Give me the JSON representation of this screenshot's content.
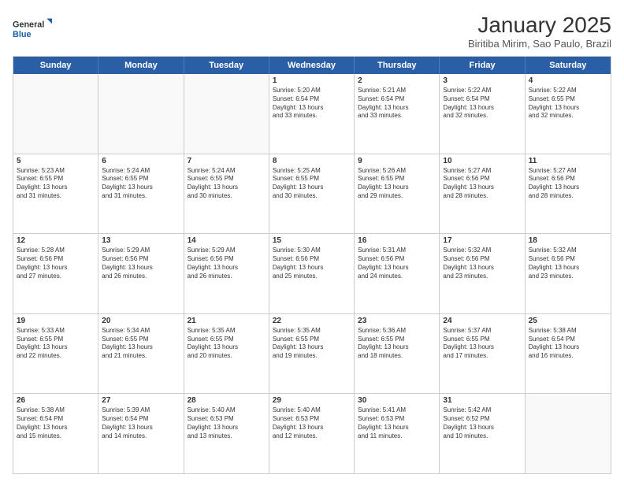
{
  "logo": {
    "line1": "General",
    "line2": "Blue"
  },
  "title": "January 2025",
  "subtitle": "Biritiba Mirim, Sao Paulo, Brazil",
  "headers": [
    "Sunday",
    "Monday",
    "Tuesday",
    "Wednesday",
    "Thursday",
    "Friday",
    "Saturday"
  ],
  "weeks": [
    [
      {
        "day": "",
        "info": ""
      },
      {
        "day": "",
        "info": ""
      },
      {
        "day": "",
        "info": ""
      },
      {
        "day": "1",
        "info": "Sunrise: 5:20 AM\nSunset: 6:54 PM\nDaylight: 13 hours\nand 33 minutes."
      },
      {
        "day": "2",
        "info": "Sunrise: 5:21 AM\nSunset: 6:54 PM\nDaylight: 13 hours\nand 33 minutes."
      },
      {
        "day": "3",
        "info": "Sunrise: 5:22 AM\nSunset: 6:54 PM\nDaylight: 13 hours\nand 32 minutes."
      },
      {
        "day": "4",
        "info": "Sunrise: 5:22 AM\nSunset: 6:55 PM\nDaylight: 13 hours\nand 32 minutes."
      }
    ],
    [
      {
        "day": "5",
        "info": "Sunrise: 5:23 AM\nSunset: 6:55 PM\nDaylight: 13 hours\nand 31 minutes."
      },
      {
        "day": "6",
        "info": "Sunrise: 5:24 AM\nSunset: 6:55 PM\nDaylight: 13 hours\nand 31 minutes."
      },
      {
        "day": "7",
        "info": "Sunrise: 5:24 AM\nSunset: 6:55 PM\nDaylight: 13 hours\nand 30 minutes."
      },
      {
        "day": "8",
        "info": "Sunrise: 5:25 AM\nSunset: 6:55 PM\nDaylight: 13 hours\nand 30 minutes."
      },
      {
        "day": "9",
        "info": "Sunrise: 5:26 AM\nSunset: 6:55 PM\nDaylight: 13 hours\nand 29 minutes."
      },
      {
        "day": "10",
        "info": "Sunrise: 5:27 AM\nSunset: 6:56 PM\nDaylight: 13 hours\nand 28 minutes."
      },
      {
        "day": "11",
        "info": "Sunrise: 5:27 AM\nSunset: 6:56 PM\nDaylight: 13 hours\nand 28 minutes."
      }
    ],
    [
      {
        "day": "12",
        "info": "Sunrise: 5:28 AM\nSunset: 6:56 PM\nDaylight: 13 hours\nand 27 minutes."
      },
      {
        "day": "13",
        "info": "Sunrise: 5:29 AM\nSunset: 6:56 PM\nDaylight: 13 hours\nand 26 minutes."
      },
      {
        "day": "14",
        "info": "Sunrise: 5:29 AM\nSunset: 6:56 PM\nDaylight: 13 hours\nand 26 minutes."
      },
      {
        "day": "15",
        "info": "Sunrise: 5:30 AM\nSunset: 6:56 PM\nDaylight: 13 hours\nand 25 minutes."
      },
      {
        "day": "16",
        "info": "Sunrise: 5:31 AM\nSunset: 6:56 PM\nDaylight: 13 hours\nand 24 minutes."
      },
      {
        "day": "17",
        "info": "Sunrise: 5:32 AM\nSunset: 6:56 PM\nDaylight: 13 hours\nand 23 minutes."
      },
      {
        "day": "18",
        "info": "Sunrise: 5:32 AM\nSunset: 6:56 PM\nDaylight: 13 hours\nand 23 minutes."
      }
    ],
    [
      {
        "day": "19",
        "info": "Sunrise: 5:33 AM\nSunset: 6:55 PM\nDaylight: 13 hours\nand 22 minutes."
      },
      {
        "day": "20",
        "info": "Sunrise: 5:34 AM\nSunset: 6:55 PM\nDaylight: 13 hours\nand 21 minutes."
      },
      {
        "day": "21",
        "info": "Sunrise: 5:35 AM\nSunset: 6:55 PM\nDaylight: 13 hours\nand 20 minutes."
      },
      {
        "day": "22",
        "info": "Sunrise: 5:35 AM\nSunset: 6:55 PM\nDaylight: 13 hours\nand 19 minutes."
      },
      {
        "day": "23",
        "info": "Sunrise: 5:36 AM\nSunset: 6:55 PM\nDaylight: 13 hours\nand 18 minutes."
      },
      {
        "day": "24",
        "info": "Sunrise: 5:37 AM\nSunset: 6:55 PM\nDaylight: 13 hours\nand 17 minutes."
      },
      {
        "day": "25",
        "info": "Sunrise: 5:38 AM\nSunset: 6:54 PM\nDaylight: 13 hours\nand 16 minutes."
      }
    ],
    [
      {
        "day": "26",
        "info": "Sunrise: 5:38 AM\nSunset: 6:54 PM\nDaylight: 13 hours\nand 15 minutes."
      },
      {
        "day": "27",
        "info": "Sunrise: 5:39 AM\nSunset: 6:54 PM\nDaylight: 13 hours\nand 14 minutes."
      },
      {
        "day": "28",
        "info": "Sunrise: 5:40 AM\nSunset: 6:53 PM\nDaylight: 13 hours\nand 13 minutes."
      },
      {
        "day": "29",
        "info": "Sunrise: 5:40 AM\nSunset: 6:53 PM\nDaylight: 13 hours\nand 12 minutes."
      },
      {
        "day": "30",
        "info": "Sunrise: 5:41 AM\nSunset: 6:53 PM\nDaylight: 13 hours\nand 11 minutes."
      },
      {
        "day": "31",
        "info": "Sunrise: 5:42 AM\nSunset: 6:52 PM\nDaylight: 13 hours\nand 10 minutes."
      },
      {
        "day": "",
        "info": ""
      }
    ]
  ]
}
